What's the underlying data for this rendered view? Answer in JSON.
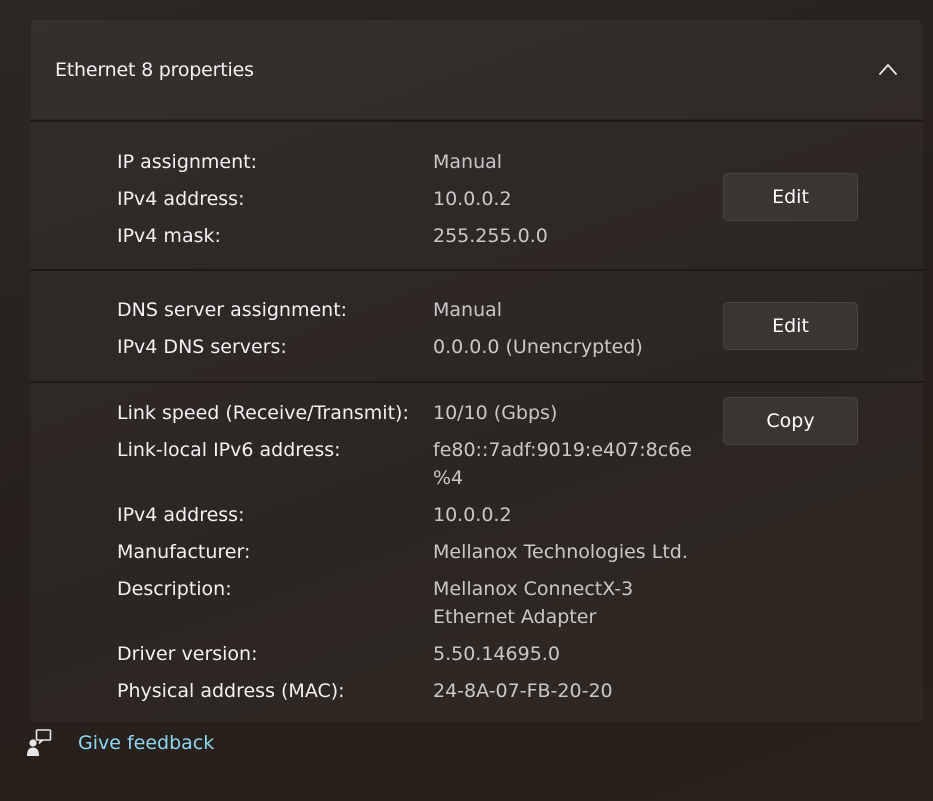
{
  "panel": {
    "title": "Ethernet 8 properties",
    "collapse_icon": "chevron-up-icon"
  },
  "ip_section": {
    "rows": [
      {
        "label": "IP assignment:",
        "value": "Manual"
      },
      {
        "label": "IPv4 address:",
        "value": "10.0.0.2"
      },
      {
        "label": "IPv4 mask:",
        "value": "255.255.0.0"
      }
    ],
    "edit_label": "Edit"
  },
  "dns_section": {
    "rows": [
      {
        "label": "DNS server assignment:",
        "value": "Manual"
      },
      {
        "label": "IPv4 DNS servers:",
        "value": "0.0.0.0 (Unencrypted)"
      }
    ],
    "edit_label": "Edit"
  },
  "details_section": {
    "rows": [
      {
        "label": "Link speed (Receive/Transmit):",
        "value": "10/10 (Gbps)"
      },
      {
        "label": "Link-local IPv6 address:",
        "value": "fe80::7adf:9019:e407:8c6e",
        "value2": "%4"
      },
      {
        "label": "IPv4 address:",
        "value": "10.0.0.2"
      },
      {
        "label": "Manufacturer:",
        "value": "Mellanox Technologies Ltd."
      },
      {
        "label": "Description:",
        "value": "Mellanox ConnectX-3",
        "value2": "Ethernet Adapter"
      },
      {
        "label": "Driver version:",
        "value": "5.50.14695.0"
      },
      {
        "label": "Physical address (MAC):",
        "value": "24-8A-07-FB-20-20"
      }
    ],
    "copy_label": "Copy"
  },
  "feedback": {
    "label": "Give feedback",
    "icon": "feedback-icon"
  },
  "colors": {
    "link": "#8dd6f5",
    "button_bg": "#3a3533"
  }
}
